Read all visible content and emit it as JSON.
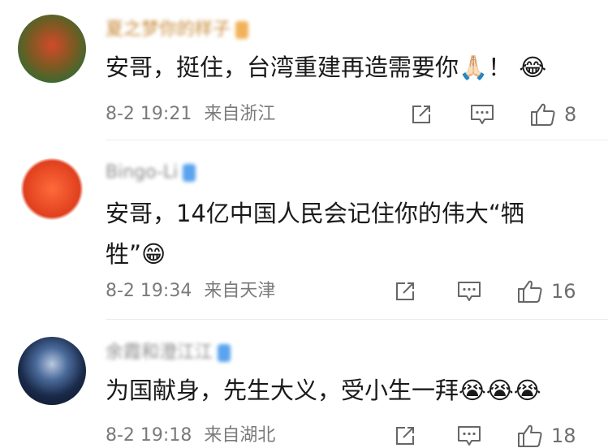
{
  "comments": [
    {
      "username": "夏之梦你的样子",
      "badge": "  ",
      "text_lines": [
        "安哥，挺住，台湾重建再造需要你🙏🏻！ 😂"
      ],
      "date": "8-2 19:21",
      "source": "来自浙江",
      "likes": "8"
    },
    {
      "username": "Bingo-Li",
      "badge": "  ",
      "text_lines": [
        "安哥，14亿中国人民会记住你的伟大“牺",
        "牲”😁"
      ],
      "date": "8-2 19:34",
      "source": "来自天津",
      "likes": "16"
    },
    {
      "username": "余霞和澄江江",
      "badge": "  ",
      "text_lines": [
        "为国献身，先生大义，受小生一拜😭😭😭"
      ],
      "date": "8-2 19:18",
      "source": "来自湖北",
      "likes": "18"
    }
  ],
  "icons": {
    "repost": "repost-icon",
    "comment": "comment-icon",
    "like": "thumbs-up-icon"
  },
  "colors": {
    "meta_text": "#7a7a7a",
    "badge_blue": "#5aa3ee",
    "badge_orange": "#f2b25a"
  }
}
